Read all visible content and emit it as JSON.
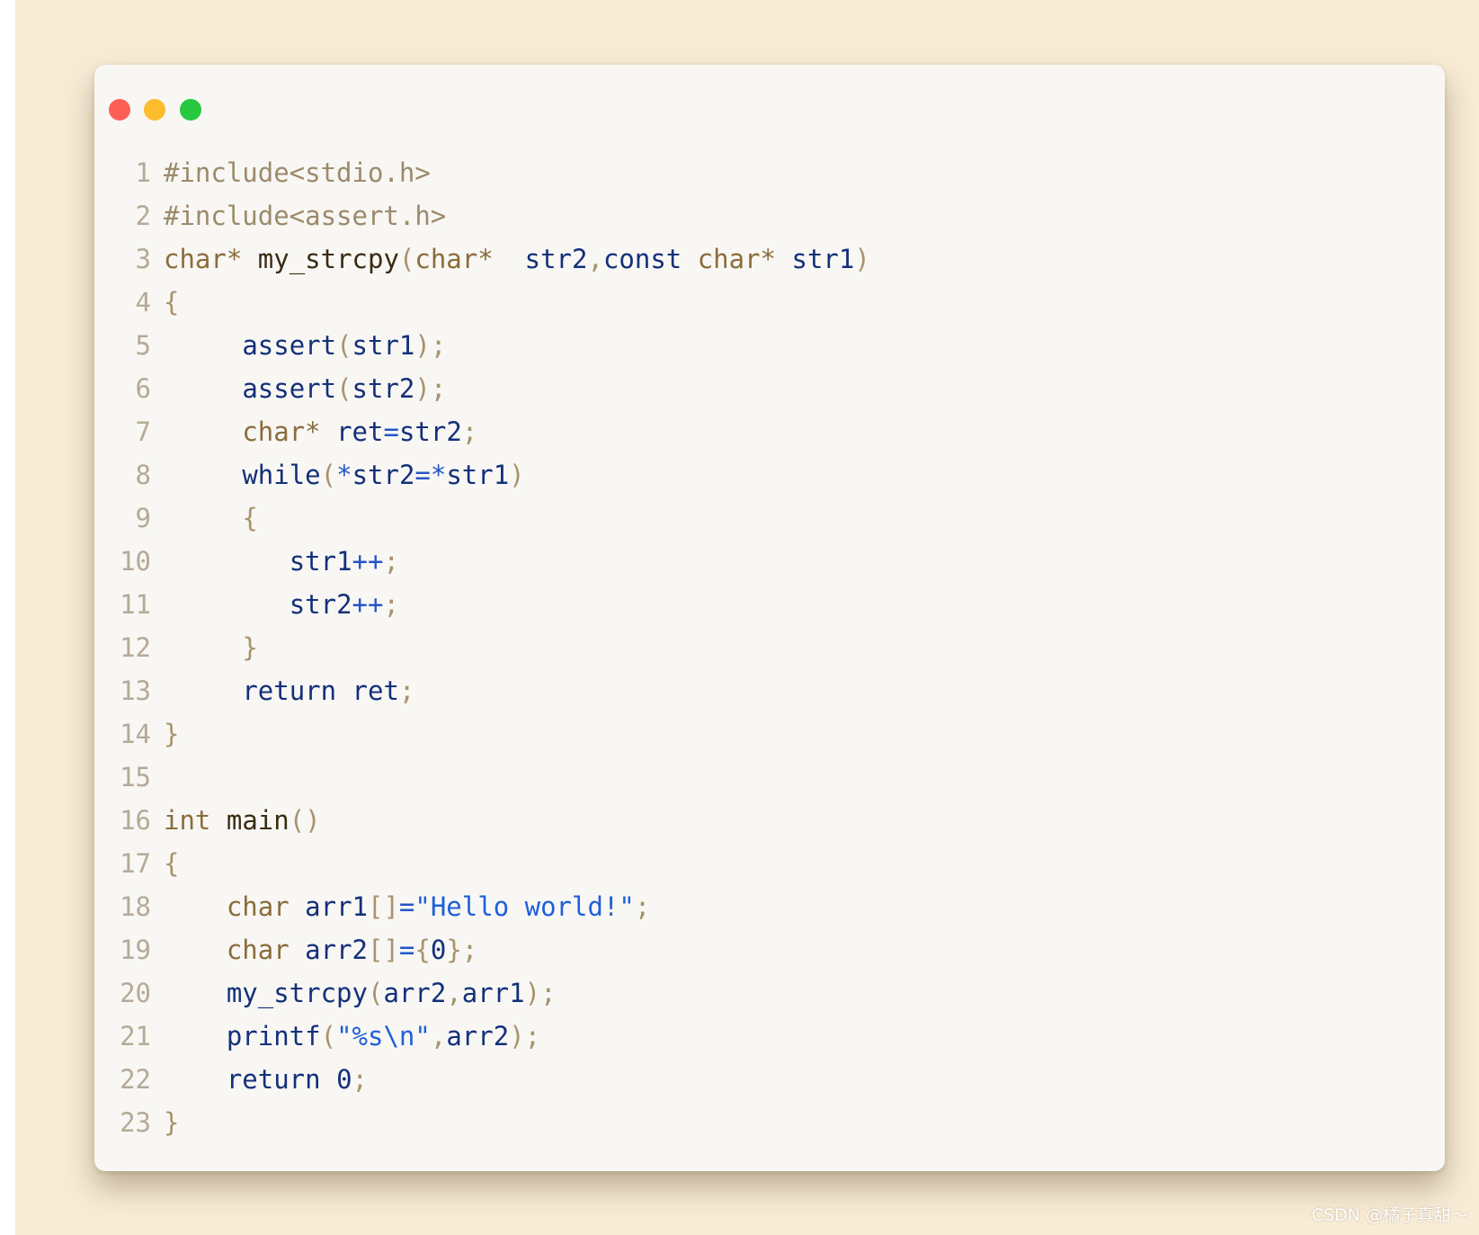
{
  "window": {
    "controls": [
      {
        "name": "close",
        "color": "#fd5f57"
      },
      {
        "name": "minimize",
        "color": "#fdbc2c"
      },
      {
        "name": "maximize",
        "color": "#27c83f"
      }
    ]
  },
  "code": {
    "lines": [
      {
        "n": "1",
        "tokens": [
          {
            "t": "#include<stdio.h>",
            "c": "pre"
          }
        ]
      },
      {
        "n": "2",
        "tokens": [
          {
            "t": "#include<assert.h>",
            "c": "pre"
          }
        ]
      },
      {
        "n": "3",
        "tokens": [
          {
            "t": "char*",
            "c": "kw"
          },
          {
            "t": " ",
            "c": "id"
          },
          {
            "t": "my_strcpy",
            "c": "fn"
          },
          {
            "t": "(",
            "c": "pun"
          },
          {
            "t": "char*",
            "c": "kw"
          },
          {
            "t": "  str2",
            "c": "id"
          },
          {
            "t": ",",
            "c": "pun"
          },
          {
            "t": "const",
            "c": "id"
          },
          {
            "t": " ",
            "c": "id"
          },
          {
            "t": "char*",
            "c": "kw"
          },
          {
            "t": " str1",
            "c": "id"
          },
          {
            "t": ")",
            "c": "pun"
          }
        ]
      },
      {
        "n": "4",
        "tokens": [
          {
            "t": "{",
            "c": "pun"
          }
        ]
      },
      {
        "n": "5",
        "tokens": [
          {
            "t": "     ",
            "c": "id"
          },
          {
            "t": "assert",
            "c": "id"
          },
          {
            "t": "(",
            "c": "pun"
          },
          {
            "t": "str1",
            "c": "id"
          },
          {
            "t": ");",
            "c": "pun"
          }
        ]
      },
      {
        "n": "6",
        "tokens": [
          {
            "t": "     ",
            "c": "id"
          },
          {
            "t": "assert",
            "c": "id"
          },
          {
            "t": "(",
            "c": "pun"
          },
          {
            "t": "str2",
            "c": "id"
          },
          {
            "t": ");",
            "c": "pun"
          }
        ]
      },
      {
        "n": "7",
        "tokens": [
          {
            "t": "     ",
            "c": "id"
          },
          {
            "t": "char*",
            "c": "kw"
          },
          {
            "t": " ret",
            "c": "id"
          },
          {
            "t": "=",
            "c": "op"
          },
          {
            "t": "str2",
            "c": "id"
          },
          {
            "t": ";",
            "c": "pun"
          }
        ]
      },
      {
        "n": "8",
        "tokens": [
          {
            "t": "     ",
            "c": "id"
          },
          {
            "t": "while",
            "c": "id"
          },
          {
            "t": "(",
            "c": "pun"
          },
          {
            "t": "*",
            "c": "op"
          },
          {
            "t": "str2",
            "c": "id"
          },
          {
            "t": "=*",
            "c": "op"
          },
          {
            "t": "str1",
            "c": "id"
          },
          {
            "t": ")",
            "c": "pun"
          }
        ]
      },
      {
        "n": "9",
        "tokens": [
          {
            "t": "     ",
            "c": "id"
          },
          {
            "t": "{",
            "c": "pun"
          }
        ]
      },
      {
        "n": "10",
        "tokens": [
          {
            "t": "        ",
            "c": "id"
          },
          {
            "t": "str1",
            "c": "id"
          },
          {
            "t": "++",
            "c": "op"
          },
          {
            "t": ";",
            "c": "pun"
          }
        ]
      },
      {
        "n": "11",
        "tokens": [
          {
            "t": "        ",
            "c": "id"
          },
          {
            "t": "str2",
            "c": "id"
          },
          {
            "t": "++",
            "c": "op"
          },
          {
            "t": ";",
            "c": "pun"
          }
        ]
      },
      {
        "n": "12",
        "tokens": [
          {
            "t": "     ",
            "c": "id"
          },
          {
            "t": "}",
            "c": "pun"
          }
        ]
      },
      {
        "n": "13",
        "tokens": [
          {
            "t": "     ",
            "c": "id"
          },
          {
            "t": "return",
            "c": "id"
          },
          {
            "t": " ret",
            "c": "id"
          },
          {
            "t": ";",
            "c": "pun"
          }
        ]
      },
      {
        "n": "14",
        "tokens": [
          {
            "t": "}",
            "c": "pun"
          }
        ]
      },
      {
        "n": "15",
        "tokens": []
      },
      {
        "n": "16",
        "tokens": [
          {
            "t": "int",
            "c": "kw"
          },
          {
            "t": " ",
            "c": "id"
          },
          {
            "t": "main",
            "c": "fn"
          },
          {
            "t": "()",
            "c": "pun"
          }
        ]
      },
      {
        "n": "17",
        "tokens": [
          {
            "t": "{",
            "c": "pun"
          }
        ]
      },
      {
        "n": "18",
        "tokens": [
          {
            "t": "    ",
            "c": "id"
          },
          {
            "t": "char",
            "c": "kw"
          },
          {
            "t": " arr1",
            "c": "id"
          },
          {
            "t": "[]",
            "c": "pun"
          },
          {
            "t": "=",
            "c": "op"
          },
          {
            "t": "\"Hello world!\"",
            "c": "str"
          },
          {
            "t": ";",
            "c": "pun"
          }
        ]
      },
      {
        "n": "19",
        "tokens": [
          {
            "t": "    ",
            "c": "id"
          },
          {
            "t": "char",
            "c": "kw"
          },
          {
            "t": " arr2",
            "c": "id"
          },
          {
            "t": "[]",
            "c": "pun"
          },
          {
            "t": "=",
            "c": "op"
          },
          {
            "t": "{",
            "c": "pun"
          },
          {
            "t": "0",
            "c": "num"
          },
          {
            "t": "};",
            "c": "pun"
          }
        ]
      },
      {
        "n": "20",
        "tokens": [
          {
            "t": "    ",
            "c": "id"
          },
          {
            "t": "my_strcpy",
            "c": "id"
          },
          {
            "t": "(",
            "c": "pun"
          },
          {
            "t": "arr2",
            "c": "id"
          },
          {
            "t": ",",
            "c": "pun"
          },
          {
            "t": "arr1",
            "c": "id"
          },
          {
            "t": ");",
            "c": "pun"
          }
        ]
      },
      {
        "n": "21",
        "tokens": [
          {
            "t": "    ",
            "c": "id"
          },
          {
            "t": "printf",
            "c": "id"
          },
          {
            "t": "(",
            "c": "pun"
          },
          {
            "t": "\"%s\\n\"",
            "c": "str"
          },
          {
            "t": ",",
            "c": "pun"
          },
          {
            "t": "arr2",
            "c": "id"
          },
          {
            "t": ");",
            "c": "pun"
          }
        ]
      },
      {
        "n": "22",
        "tokens": [
          {
            "t": "    ",
            "c": "id"
          },
          {
            "t": "return",
            "c": "id"
          },
          {
            "t": " 0",
            "c": "num"
          },
          {
            "t": ";",
            "c": "pun"
          }
        ]
      },
      {
        "n": "23",
        "tokens": [
          {
            "t": "}",
            "c": "pun"
          }
        ]
      }
    ]
  },
  "watermark": "CSDN @橘子真甜～"
}
